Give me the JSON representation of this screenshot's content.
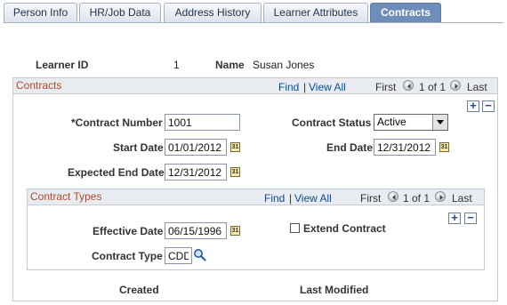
{
  "tabs": [
    {
      "label": "Person Info",
      "active": false
    },
    {
      "label": "HR/Job Data",
      "active": false
    },
    {
      "label": "Address History",
      "active": false
    },
    {
      "label": "Learner Attributes",
      "active": false
    },
    {
      "label": "Contracts",
      "active": true
    }
  ],
  "header": {
    "learner_id_label": "Learner ID",
    "learner_id_value": "1",
    "name_label": "Name",
    "name_value": "Susan Jones"
  },
  "contracts": {
    "title": "Contracts",
    "find": "Find",
    "separator": "|",
    "view_all": "View All",
    "first": "First",
    "count": "1 of 1",
    "last": "Last",
    "contract_number_label": "*Contract Number",
    "contract_number_value": "1001",
    "contract_status_label": "Contract Status",
    "contract_status_value": "Active",
    "start_date_label": "Start Date",
    "start_date_value": "01/01/2012",
    "end_date_label": "End Date",
    "end_date_value": "12/31/2012",
    "expected_end_date_label": "Expected End Date",
    "expected_end_date_value": "12/31/2012"
  },
  "contract_types": {
    "title": "Contract Types",
    "find": "Find",
    "separator": "|",
    "view_all": "View All",
    "first": "First",
    "count": "1 of 1",
    "last": "Last",
    "effective_date_label": "Effective Date",
    "effective_date_value": "06/15/1996",
    "extend_contract_label": "Extend Contract",
    "extend_contract_checked": false,
    "contract_type_label": "Contract Type",
    "contract_type_value": "CDD"
  },
  "footer": {
    "created_label": "Created",
    "last_modified_label": "Last Modified"
  },
  "icons": {
    "calendar": "calendar-icon",
    "lookup": "magnifier-icon",
    "add": "plus-icon",
    "remove": "minus-icon",
    "prev": "previous-arrow-icon",
    "next": "next-arrow-icon"
  },
  "calendar_glyph": "31",
  "plus_glyph": "+",
  "minus_glyph": "−",
  "colors": {
    "active_tab": "#6f8dbb",
    "group_title": "#b04a2c",
    "link": "#0b4d99"
  }
}
